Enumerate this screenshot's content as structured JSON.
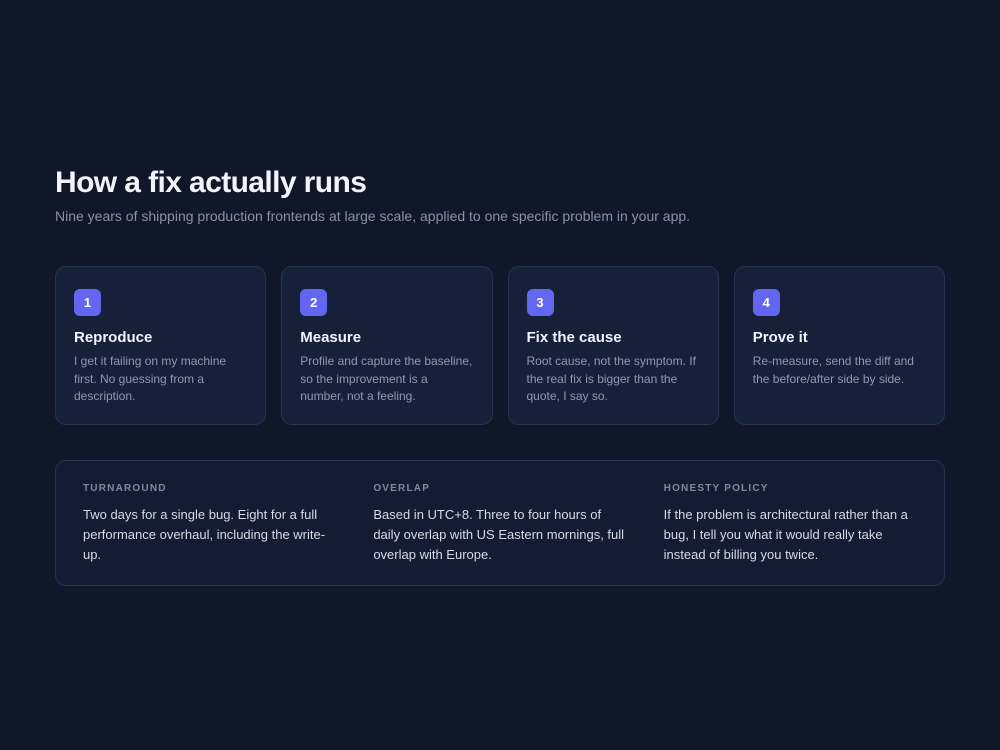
{
  "header": {
    "title": "How a fix actually runs",
    "subtitle": "Nine years of shipping production frontends at large scale, applied to one specific problem in your app."
  },
  "steps": [
    {
      "number": "1",
      "title": "Reproduce",
      "description": "I get it failing on my machine first. No guessing from a description."
    },
    {
      "number": "2",
      "title": "Measure",
      "description": "Profile and capture the baseline, so the improvement is a number, not a feeling."
    },
    {
      "number": "3",
      "title": "Fix the cause",
      "description": "Root cause, not the symptom. If the real fix is bigger than the quote, I say so."
    },
    {
      "number": "4",
      "title": "Prove it",
      "description": "Re-measure, send the diff and the before/after side by side."
    }
  ],
  "info": [
    {
      "label": "TURNAROUND",
      "text": "Two days for a single bug. Eight for a full performance overhaul, including the write-up."
    },
    {
      "label": "OVERLAP",
      "text": "Based in UTC+8. Three to four hours of daily overlap with US Eastern mornings, full overlap with Europe."
    },
    {
      "label": "HONESTY POLICY",
      "text": "If the problem is architectural rather than a bug, I tell you what it would really take instead of billing you twice."
    }
  ],
  "colors": {
    "background": "#0f1729",
    "card": "#162039",
    "accent": "#6366f1"
  }
}
